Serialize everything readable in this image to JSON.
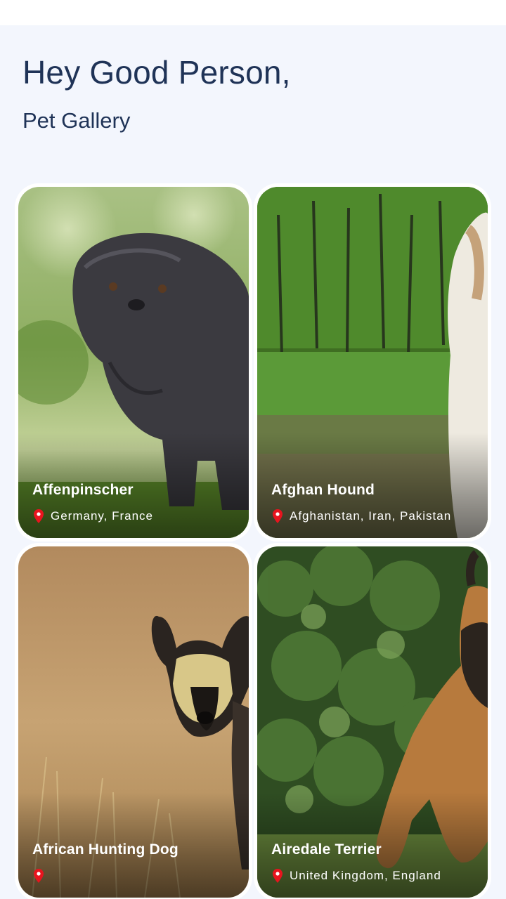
{
  "header": {
    "greeting": "Hey Good Person,",
    "subtitle": "Pet Gallery"
  },
  "pets": [
    {
      "name": "Affenpinscher",
      "origin": "Germany, France",
      "photo_icon": "dog-photo"
    },
    {
      "name": "Afghan Hound",
      "origin": "Afghanistan, Iran, Pakistan",
      "photo_icon": "dog-photo"
    },
    {
      "name": "African Hunting Dog",
      "origin": "",
      "photo_icon": "dog-photo"
    },
    {
      "name": "Airedale Terrier",
      "origin": "United Kingdom, England",
      "photo_icon": "dog-photo"
    }
  ],
  "icons": {
    "location": "map-pin-icon"
  },
  "colors": {
    "heading": "#1f3357",
    "background": "#f3f6fd",
    "pin": "#e8141e"
  }
}
